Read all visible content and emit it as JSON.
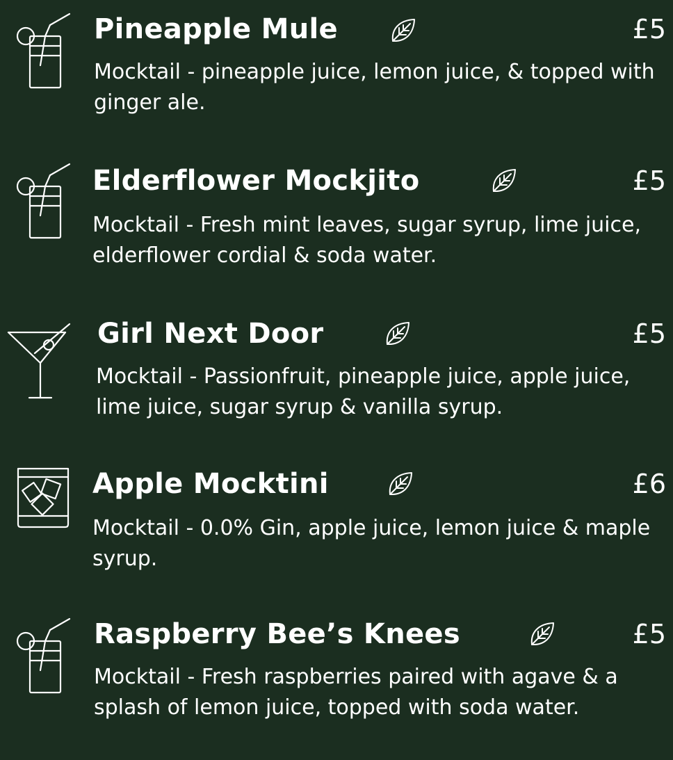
{
  "colors": {
    "background": "#1b2e20",
    "text": "#ffffff"
  },
  "items": [
    {
      "name": "Pineapple Mule",
      "price": "£5",
      "description": "Mocktail - pineapple juice, lemon juice, & topped with ginger ale.",
      "icon": "highball-straw-icon",
      "vegan_icon": "leaf-icon"
    },
    {
      "name": "Elderflower Mockjito",
      "price": "£5",
      "description": "Mocktail - Fresh mint leaves, sugar syrup, lime juice, elderflower cordial & soda water.",
      "icon": "highball-straw-icon",
      "vegan_icon": "leaf-icon"
    },
    {
      "name": "Girl Next Door",
      "price": "£5",
      "description": "Mocktail - Passionfruit, pineapple juice, apple juice, lime juice, sugar syrup & vanilla syrup.",
      "icon": "martini-glass-icon",
      "vegan_icon": "leaf-icon"
    },
    {
      "name": "Apple Mocktini",
      "price": "£6",
      "description": "Mocktail - 0.0% Gin, apple juice, lemon juice & maple syrup.",
      "icon": "rocks-glass-ice-icon",
      "vegan_icon": "leaf-icon"
    },
    {
      "name": "Raspberry Bee’s Knees",
      "price": "£5",
      "description": "Mocktail - Fresh raspberries paired with agave & a splash of lemon juice, topped with soda water.",
      "icon": "highball-straw-icon",
      "vegan_icon": "leaf-icon"
    }
  ]
}
